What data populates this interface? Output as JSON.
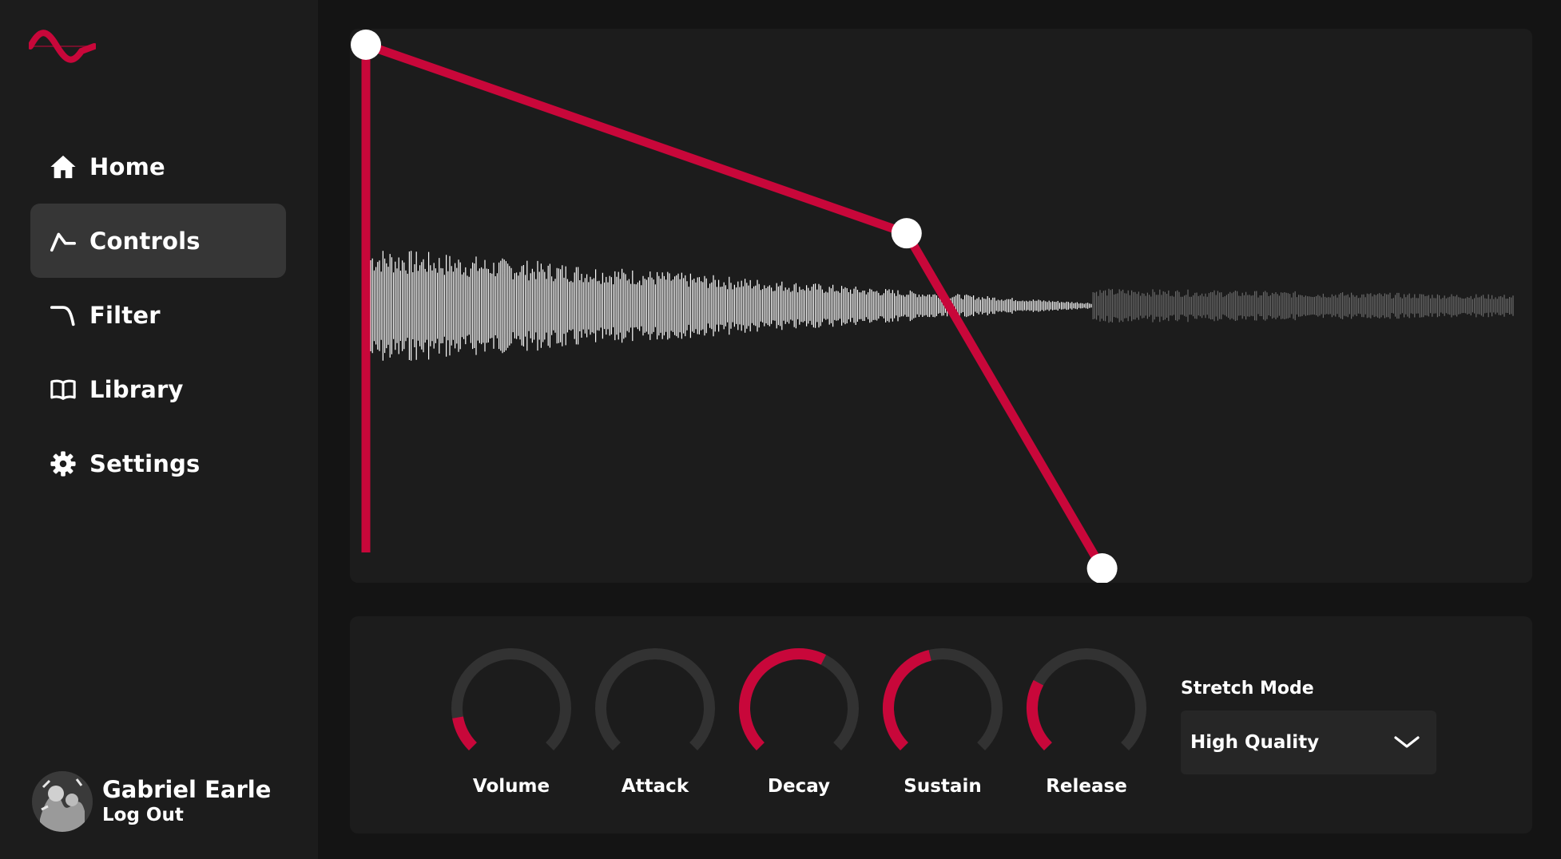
{
  "colors": {
    "accent": "#c8073a",
    "panel": "#1c1c1c",
    "active_nav": "#363636",
    "knob_track": "#323232"
  },
  "sidebar": {
    "logo_icon": "wave-logo-icon",
    "items": [
      {
        "label": "Home",
        "icon": "home-icon",
        "active": false
      },
      {
        "label": "Controls",
        "icon": "envelope-icon",
        "active": true
      },
      {
        "label": "Filter",
        "icon": "filter-curve-icon",
        "active": false
      },
      {
        "label": "Library",
        "icon": "book-icon",
        "active": false
      },
      {
        "label": "Settings",
        "icon": "gear-icon",
        "active": false
      }
    ],
    "user": {
      "name": "Gabriel Earle",
      "logout_label": "Log Out"
    }
  },
  "envelope": {
    "points": [
      {
        "t": 0.0,
        "level": 1.0
      },
      {
        "t": 0.47,
        "level": 0.64
      },
      {
        "t": 0.64,
        "level": 0.0
      }
    ]
  },
  "knobs": [
    {
      "label": "Volume",
      "value": 0.13
    },
    {
      "label": "Attack",
      "value": 0.0
    },
    {
      "label": "Decay",
      "value": 0.6
    },
    {
      "label": "Sustain",
      "value": 0.45
    },
    {
      "label": "Release",
      "value": 0.27
    }
  ],
  "stretch_mode": {
    "label": "Stretch Mode",
    "value": "High Quality"
  }
}
